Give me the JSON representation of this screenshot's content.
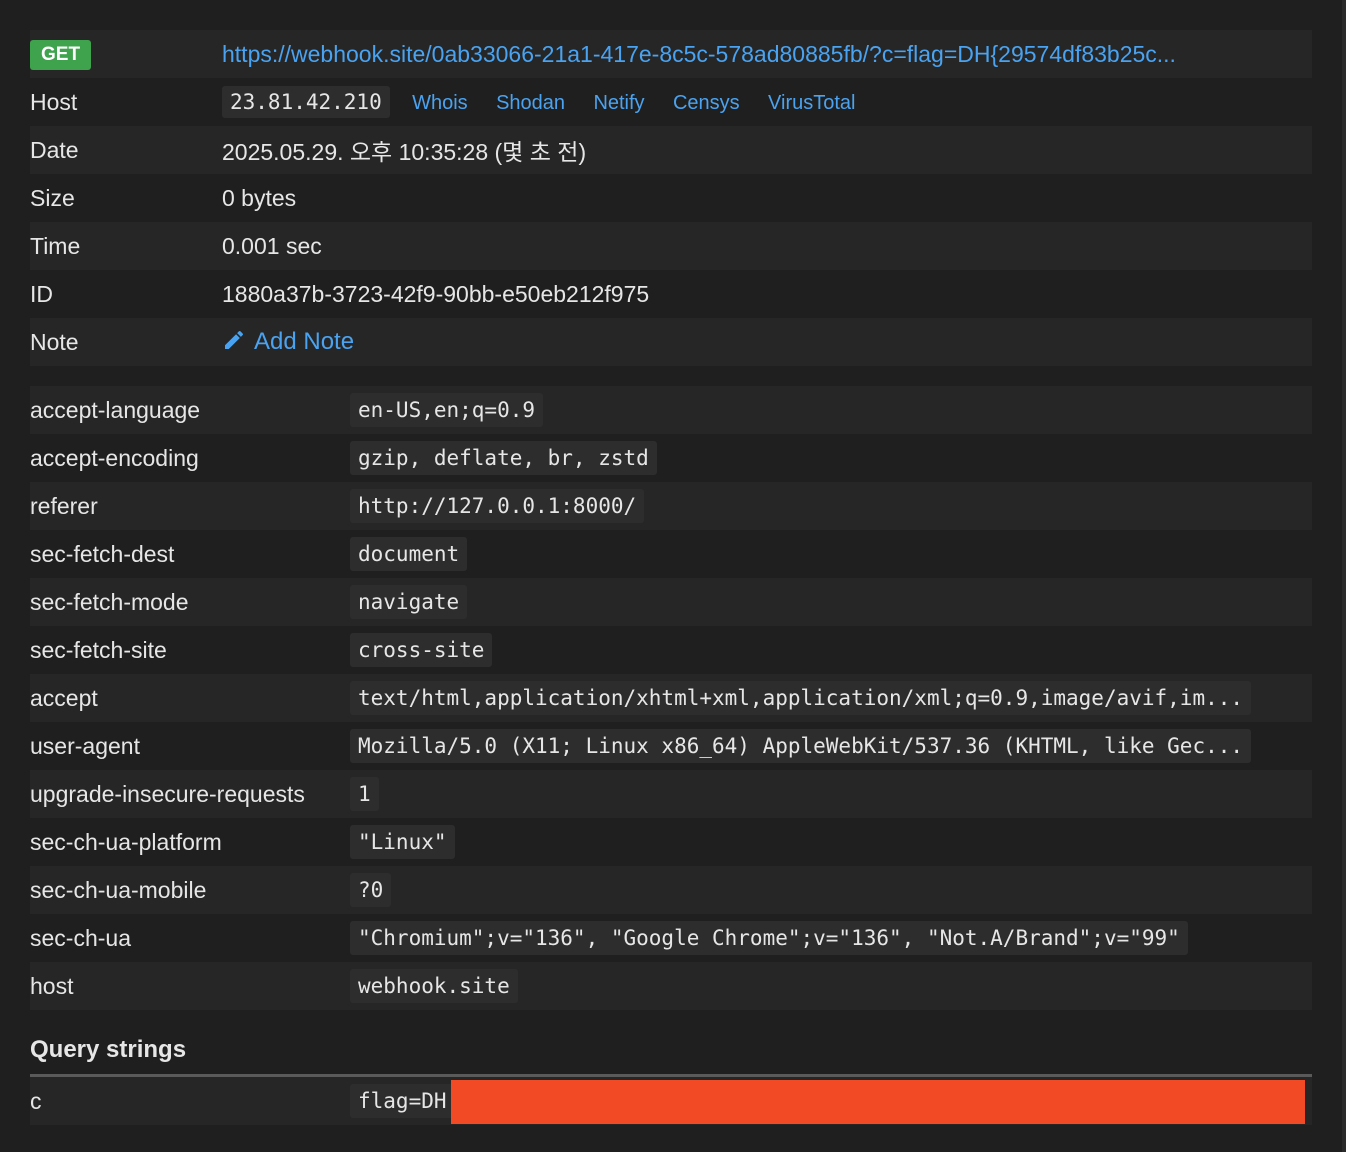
{
  "request": {
    "method": "GET",
    "url": "https://webhook.site/0ab33066-21a1-417e-8c5c-578ad80885fb/?c=flag=DH{29574df83b25c...",
    "fields": [
      {
        "key": "Host",
        "value": "23.81.42.210"
      },
      {
        "key": "Date",
        "value": "2025.05.29. 오후 10:35:28 (몇 초 전)"
      },
      {
        "key": "Size",
        "value": "0 bytes"
      },
      {
        "key": "Time",
        "value": "0.001 sec"
      },
      {
        "key": "ID",
        "value": "1880a37b-3723-42f9-90bb-e50eb212f975"
      },
      {
        "key": "Note",
        "value": "Add Note"
      }
    ],
    "host_links": [
      "Whois",
      "Shodan",
      "Netify",
      "Censys",
      "VirusTotal"
    ]
  },
  "headers": [
    {
      "key": "accept-language",
      "value": "en-US,en;q=0.9"
    },
    {
      "key": "accept-encoding",
      "value": "gzip, deflate, br, zstd"
    },
    {
      "key": "referer",
      "value": "http://127.0.0.1:8000/"
    },
    {
      "key": "sec-fetch-dest",
      "value": "document"
    },
    {
      "key": "sec-fetch-mode",
      "value": "navigate"
    },
    {
      "key": "sec-fetch-site",
      "value": "cross-site"
    },
    {
      "key": "accept",
      "value": "text/html,application/xhtml+xml,application/xml;q=0.9,image/avif,im..."
    },
    {
      "key": "user-agent",
      "value": "Mozilla/5.0 (X11; Linux x86_64) AppleWebKit/537.36 (KHTML, like Gec..."
    },
    {
      "key": "upgrade-insecure-requests",
      "value": "1"
    },
    {
      "key": "sec-ch-ua-platform",
      "value": "\"Linux\""
    },
    {
      "key": "sec-ch-ua-mobile",
      "value": "?0"
    },
    {
      "key": "sec-ch-ua",
      "value": "\"Chromium\";v=\"136\", \"Google Chrome\";v=\"136\", \"Not.A/Brand\";v=\"99\""
    },
    {
      "key": "host",
      "value": "webhook.site"
    }
  ],
  "query_strings": {
    "title": "Query strings",
    "items": [
      {
        "key": "c",
        "value": "flag=DH"
      }
    ]
  },
  "colors": {
    "accent_link": "#4aa3f0",
    "method_badge": "#3fa34d",
    "redaction": "#f14a24"
  },
  "icons": {
    "note": "pencil-icon"
  }
}
